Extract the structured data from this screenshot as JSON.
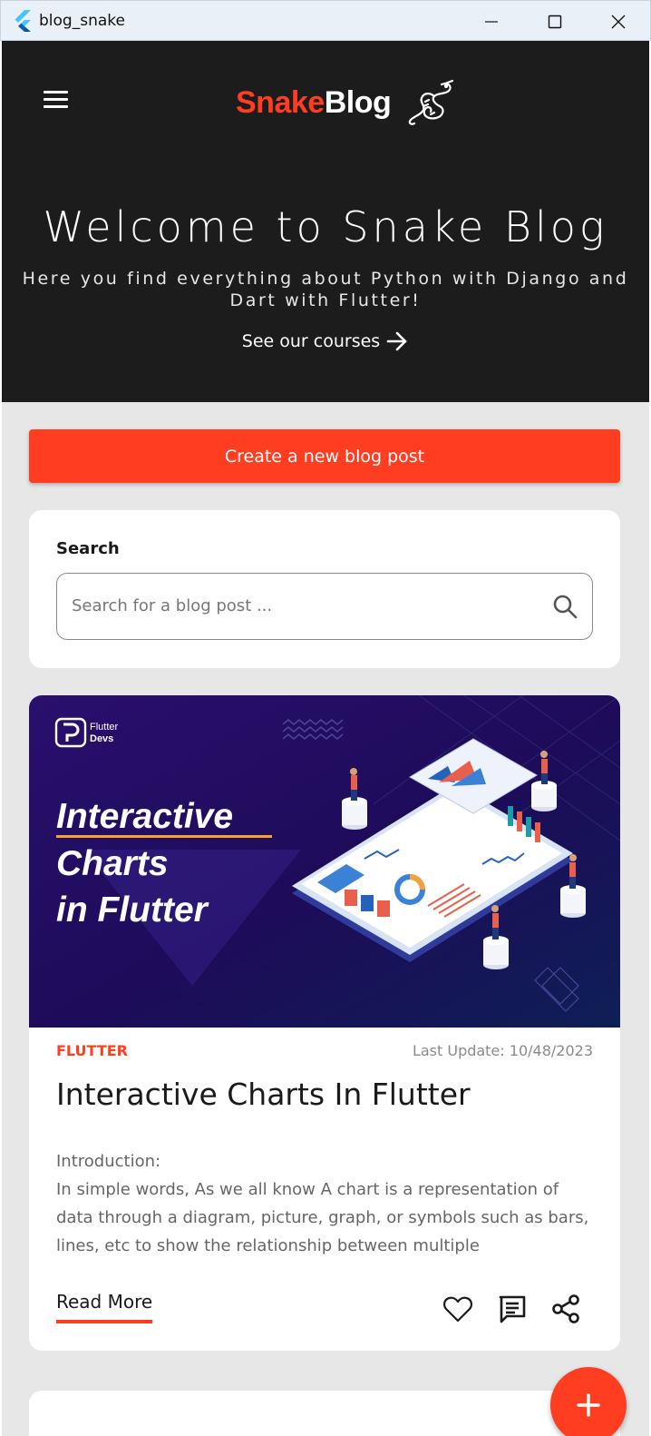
{
  "window": {
    "title": "blog_snake",
    "icon": "flutter-icon",
    "controls": [
      "minimize-icon",
      "maximize-icon",
      "close-icon"
    ]
  },
  "header": {
    "menu_icon": "hamburger-menu-icon",
    "logo": {
      "part1": "Snake",
      "part2": "Blog",
      "icon": "snake-logo-icon"
    }
  },
  "hero": {
    "title": "Welcome to Snake Blog",
    "subtitle": "Here you find everything about Python with Django and Dart with Flutter!",
    "link_label": "See our courses",
    "link_icon": "arrow-right-icon"
  },
  "create_button": {
    "label": "Create a new blog post"
  },
  "search": {
    "label": "Search",
    "placeholder": "Search for a blog post ...",
    "value": "",
    "icon": "search-icon"
  },
  "post": {
    "image": {
      "brand_line1": "Flutter",
      "brand_line2": "Devs",
      "headline_line1": "Interactive",
      "headline_line2": "Charts",
      "headline_line3": "in Flutter"
    },
    "category": "FLUTTER",
    "last_update": "Last Update: 10/48/2023",
    "title": "Interactive Charts In Flutter",
    "excerpt": "Introduction:\nIn simple words, As we all know A chart is a representation of data through a diagram, picture, graph, or symbols such as bars, lines, etc to show the relationship between multiple",
    "read_more": "Read More",
    "actions": [
      "heart-icon",
      "comment-icon",
      "share-icon"
    ]
  },
  "fab": {
    "icon": "plus-icon"
  },
  "colors": {
    "accent": "#ff3d21",
    "hero_bg": "#1c1c1c",
    "page_bg": "#e7e7e7",
    "card_bg": "#ffffff",
    "image_bg": "#2a0f6e"
  }
}
